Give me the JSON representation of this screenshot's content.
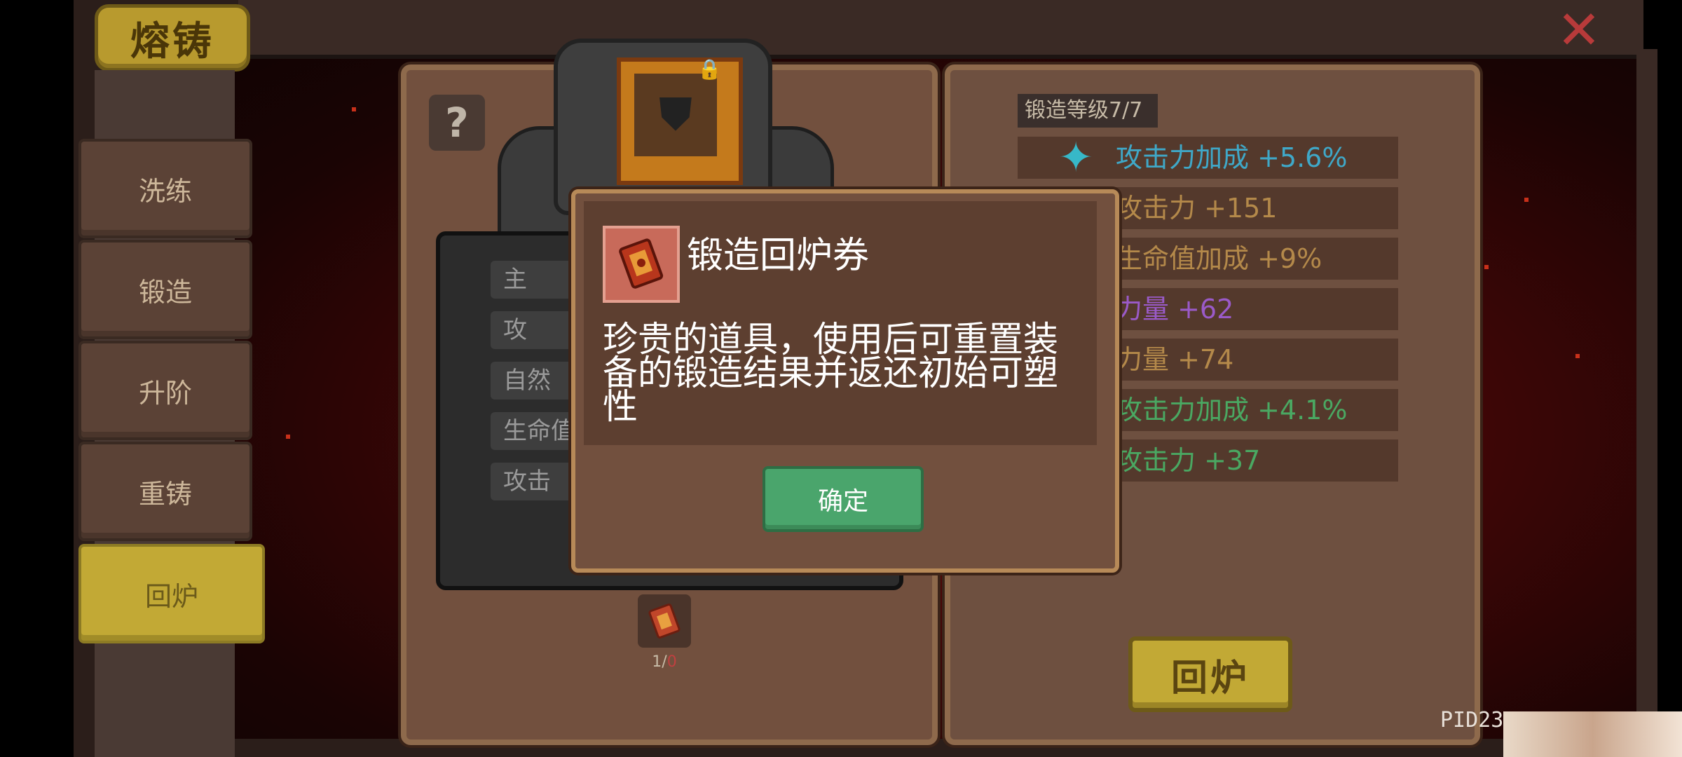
{
  "title": "熔铸",
  "close_icon": "close-x-icon",
  "sidebar": {
    "items": [
      {
        "label": "洗练",
        "active": false
      },
      {
        "label": "锻造",
        "active": false
      },
      {
        "label": "升阶",
        "active": false
      },
      {
        "label": "重铸",
        "active": false
      },
      {
        "label": "回炉",
        "active": true
      }
    ]
  },
  "left_panel": {
    "help_label": "?",
    "stat_slots": [
      "主",
      "攻",
      "自然",
      "生命值",
      "攻击"
    ],
    "ticket_count": {
      "current": "1",
      "sep": "/",
      "required": "0"
    }
  },
  "right_panel": {
    "forge_level": "锻造等级7/7",
    "attributes": [
      {
        "text": "攻击力加成 +5.6%",
        "color": "#3fa8c8"
      },
      {
        "text": "攻击力 +151",
        "color": "#b4894a"
      },
      {
        "text": "生命值加成 +9%",
        "color": "#b4894a"
      },
      {
        "text": "力量 +62",
        "color": "#9a5ac8"
      },
      {
        "text": "力量 +74",
        "color": "#b4894a"
      },
      {
        "text": "攻击力加成 +4.1%",
        "color": "#4aa862"
      },
      {
        "text": "攻击力 +37",
        "color": "#4aa862"
      }
    ],
    "recast_button": "回炉"
  },
  "dialog": {
    "item_name": "锻造回炉券",
    "item_icon": "recast-ticket-icon",
    "description": "珍贵的道具，使用后可重置装备的锻造结果并返还初始可塑性",
    "confirm_label": "确定"
  },
  "player_id": "PID23"
}
